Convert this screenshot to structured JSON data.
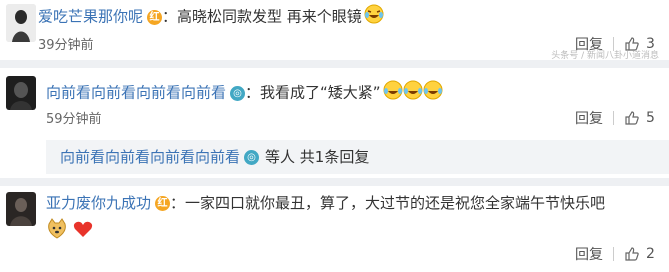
{
  "comments": [
    {
      "user": "爱吃芒果那你呢",
      "badge": "红",
      "text": "：高晓松同款发型  再来个眼镜",
      "time": "39分钟前",
      "reply_label": "回复",
      "likes": "3"
    },
    {
      "user": "向前看向前看向前看向前看",
      "badge": "◎",
      "text": "：我看成了“矮大紧”",
      "time": "59分钟前",
      "reply_label": "回复",
      "likes": "5"
    },
    {
      "user": "亚力废你九成功",
      "badge": "红",
      "text": "：一家四口就你最丑，算了，大过节的还是祝您全家端午节快乐吧",
      "time": "59分钟前",
      "reply_label": "回复",
      "likes": "2"
    }
  ],
  "reply_summary": {
    "user": "向前看向前看向前看向前看",
    "badge": "◎",
    "text": "等人 共1条回复"
  },
  "watermark": "头条号 / 新闻八卦小道消息",
  "colors": {
    "username": "#3b73b5",
    "badge_orange": "#f5a623",
    "badge_blue": "#42a8c4",
    "separator": "#eef0f3",
    "reply_bg": "#f2f4f6"
  }
}
